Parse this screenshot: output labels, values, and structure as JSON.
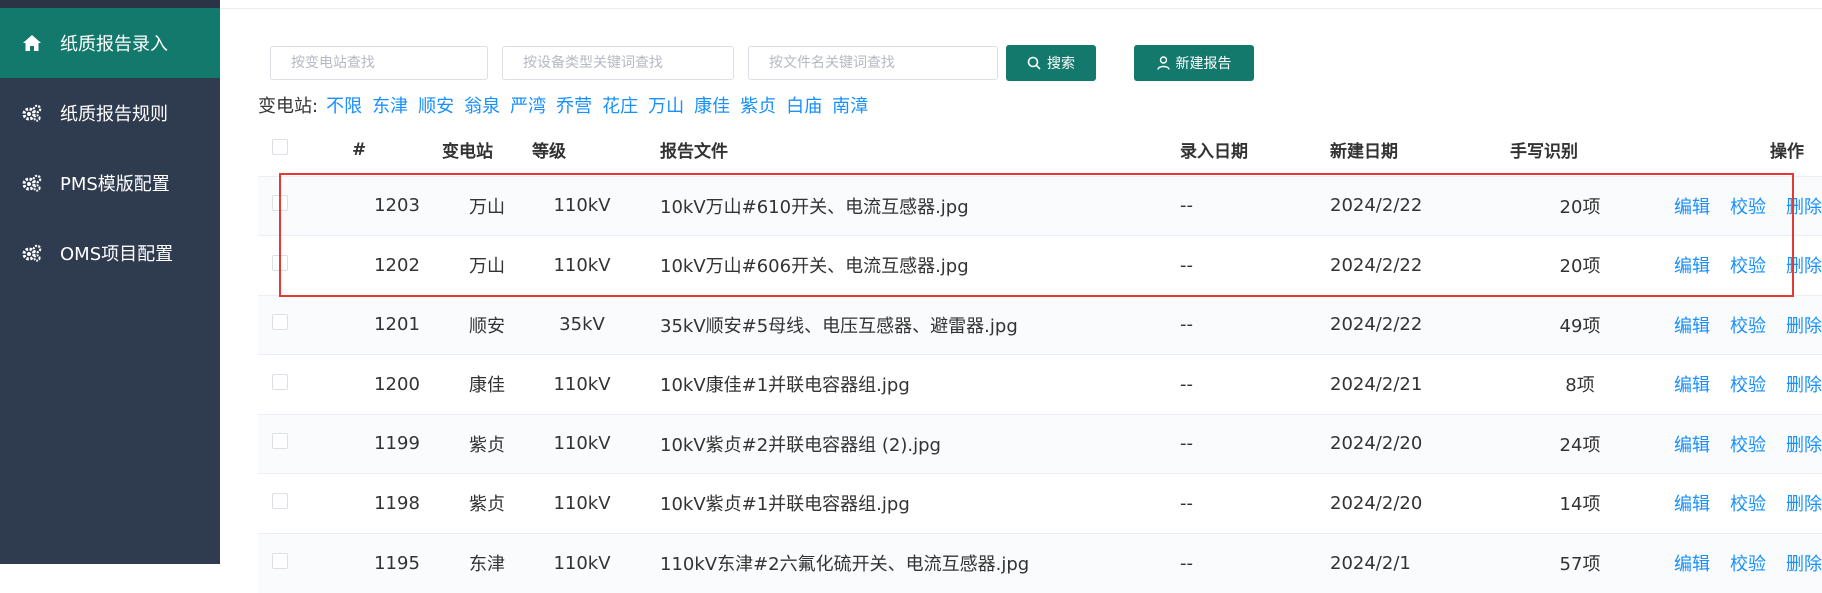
{
  "sidebar": {
    "items": [
      {
        "label": "纸质报告录入",
        "icon": "home-icon",
        "active": true
      },
      {
        "label": "纸质报告规则",
        "icon": "gears-icon",
        "active": false
      },
      {
        "label": "PMS模版配置",
        "icon": "gears-icon",
        "active": false
      },
      {
        "label": "OMS项目配置",
        "icon": "gears-icon",
        "active": false
      }
    ]
  },
  "search": {
    "station_placeholder": "按变电站查找",
    "device_placeholder": "按设备类型关键词查找",
    "file_placeholder": "按文件名关键词查找",
    "search_label": "搜索",
    "new_report_label": "新建报告"
  },
  "filter": {
    "label": "变电站:",
    "stations": [
      "不限",
      "东津",
      "顺安",
      "翁泉",
      "严湾",
      "乔营",
      "花庄",
      "万山",
      "康佳",
      "紫贞",
      "白庙",
      "南漳"
    ]
  },
  "table": {
    "headers": [
      "#",
      "变电站",
      "等级",
      "报告文件",
      "录入日期",
      "新建日期",
      "手写识别",
      "操作"
    ],
    "rows": [
      {
        "id": "1203",
        "station": "万山",
        "level": "110kV",
        "file": "10kV万山#610开关、电流互感器.jpg",
        "entry_date": "--",
        "created": "2024/2/22",
        "handwriting": "20项"
      },
      {
        "id": "1202",
        "station": "万山",
        "level": "110kV",
        "file": "10kV万山#606开关、电流互感器.jpg",
        "entry_date": "--",
        "created": "2024/2/22",
        "handwriting": "20项"
      },
      {
        "id": "1201",
        "station": "顺安",
        "level": "35kV",
        "file": "35kV顺安#5母线、电压互感器、避雷器.jpg",
        "entry_date": "--",
        "created": "2024/2/22",
        "handwriting": "49项"
      },
      {
        "id": "1200",
        "station": "康佳",
        "level": "110kV",
        "file": "10kV康佳#1并联电容器组.jpg",
        "entry_date": "--",
        "created": "2024/2/21",
        "handwriting": "8项"
      },
      {
        "id": "1199",
        "station": "紫贞",
        "level": "110kV",
        "file": "10kV紫贞#2并联电容器组 (2).jpg",
        "entry_date": "--",
        "created": "2024/2/20",
        "handwriting": "24项"
      },
      {
        "id": "1198",
        "station": "紫贞",
        "level": "110kV",
        "file": "10kV紫贞#1并联电容器组.jpg",
        "entry_date": "--",
        "created": "2024/2/20",
        "handwriting": "14项"
      },
      {
        "id": "1195",
        "station": "东津",
        "level": "110kV",
        "file": "110kV东津#2六氟化硫开关、电流互感器.jpg",
        "entry_date": "--",
        "created": "2024/2/1",
        "handwriting": "57项"
      }
    ],
    "actions": {
      "edit": "编辑",
      "verify": "校验",
      "delete": "删除"
    }
  },
  "colors": {
    "sidebar_bg": "#2f3b4e",
    "accent": "#13796c",
    "link": "#1890ff",
    "count": "#2ebf3a",
    "highlight": "#e53935"
  }
}
